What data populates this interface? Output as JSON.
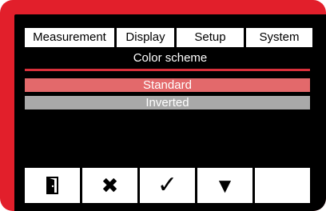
{
  "tabs": [
    {
      "label": "Measurement"
    },
    {
      "label": "Display"
    },
    {
      "label": "Setup"
    },
    {
      "label": "System"
    }
  ],
  "section": {
    "title": "Color scheme"
  },
  "options": [
    {
      "label": "Standard",
      "state": "selected"
    },
    {
      "label": "Inverted",
      "state": "unselected"
    }
  ],
  "softkeys": [
    {
      "icon": "exit-door-icon"
    },
    {
      "icon": "cancel-x-icon",
      "glyph": "✖"
    },
    {
      "icon": "confirm-check-icon",
      "glyph": "✓"
    },
    {
      "icon": "down-arrow-icon",
      "glyph": "▼"
    },
    {
      "icon": "blank"
    }
  ],
  "colors": {
    "frame": "#e21f2b",
    "screen": "#000000",
    "selected_option": "#e3696b",
    "unselected_option": "#a9a9a9",
    "divider": "#d8303b"
  }
}
